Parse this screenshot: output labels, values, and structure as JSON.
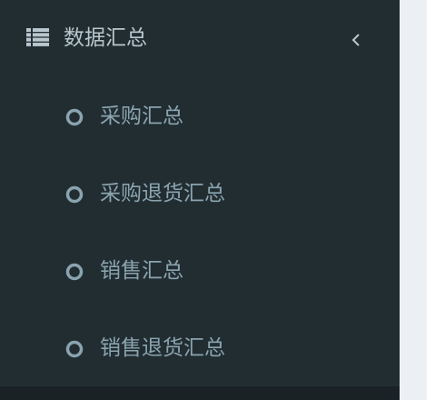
{
  "sidebar": {
    "section": {
      "label": "数据汇总",
      "icon": "list-icon",
      "toggle_icon": "chevron-left-icon",
      "expanded": true
    },
    "items": [
      {
        "label": "采购汇总",
        "icon": "circle-outline-icon"
      },
      {
        "label": "采购退货汇总",
        "icon": "circle-outline-icon"
      },
      {
        "label": "销售汇总",
        "icon": "circle-outline-icon"
      },
      {
        "label": "销售退货汇总",
        "icon": "circle-outline-icon"
      }
    ]
  },
  "colors": {
    "sidebar_bg": "#222d32",
    "sidebar_bottom": "#1a2226",
    "header_text": "#b8c7ce",
    "item_text": "#8aa4af",
    "content_bg": "#ecf0f5",
    "panel_bg": "#ffffff"
  }
}
